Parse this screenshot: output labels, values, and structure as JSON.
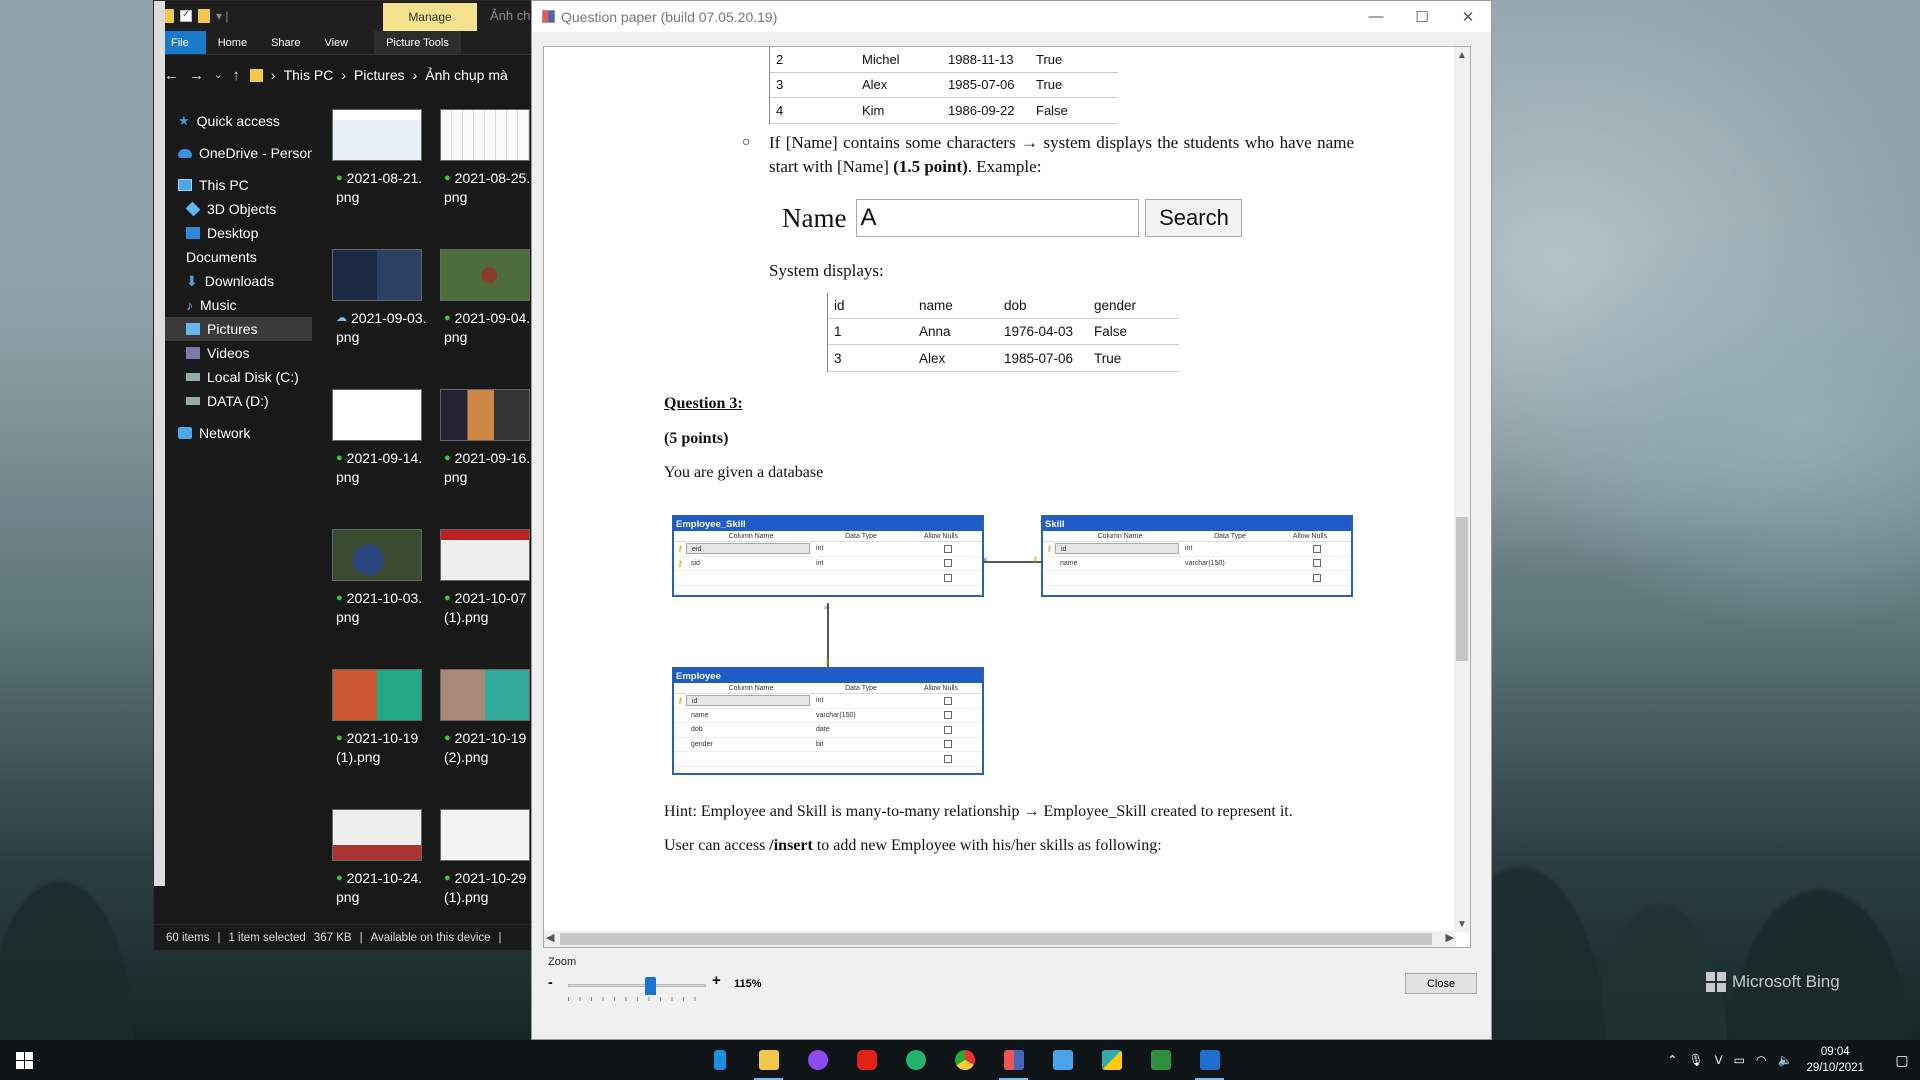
{
  "explorer": {
    "manage_label": "Manage",
    "title_partial": "Ảnh ch",
    "ribbon": {
      "file": "File",
      "home": "Home",
      "share": "Share",
      "view": "View",
      "picture_tools": "Picture Tools"
    },
    "address": {
      "this_pc": "This PC",
      "pictures": "Pictures",
      "folder": "Ảnh chụp mà"
    },
    "nav": {
      "quick_access": "Quick access",
      "onedrive": "OneDrive - Person",
      "this_pc": "This PC",
      "objects3d": "3D Objects",
      "desktop": "Desktop",
      "documents": "Documents",
      "downloads": "Downloads",
      "music": "Music",
      "pictures": "Pictures",
      "videos": "Videos",
      "local_disk": "Local Disk (C:)",
      "data": "DATA (D:)",
      "network": "Network"
    },
    "files": [
      {
        "l1": "2021-08-21.",
        "l2": "png"
      },
      {
        "l1": "2021-08-25.",
        "l2": "png"
      },
      {
        "l1": "2021-09-03.",
        "l2": "png"
      },
      {
        "l1": "2021-09-04.",
        "l2": "png"
      },
      {
        "l1": "2021-09-14.",
        "l2": "png"
      },
      {
        "l1": "2021-09-16.",
        "l2": "png"
      },
      {
        "l1": "2021-10-03.",
        "l2": "png"
      },
      {
        "l1": "2021-10-07",
        "l2": "(1).png"
      },
      {
        "l1": "2021-10-19",
        "l2": "(1).png"
      },
      {
        "l1": "2021-10-19",
        "l2": "(2).png"
      },
      {
        "l1": "2021-10-24.",
        "l2": "png"
      },
      {
        "l1": "2021-10-29",
        "l2": "(1).png"
      }
    ],
    "status": {
      "items": "60 items",
      "selected": "1 item selected",
      "size": "367 KB",
      "availability": "Available on this device"
    }
  },
  "qp": {
    "title": "Question paper (build 07.05.20.19)",
    "top_table": [
      {
        "id": "2",
        "name": "Michel",
        "dob": "1988-11-13",
        "gender": "True"
      },
      {
        "id": "3",
        "name": "Alex",
        "dob": "1985-07-06",
        "gender": "True"
      },
      {
        "id": "4",
        "name": "Kim",
        "dob": "1986-09-22",
        "gender": "False"
      }
    ],
    "bullet_a": "If [Name] contains some characters",
    "bullet_b": " system displays the students who have name start with [Name] ",
    "bullet_bold": "(1.5 point)",
    "bullet_c": ". Example:",
    "search_label": "Name",
    "search_value": "A",
    "search_button": "Search",
    "system_displays": "System displays:",
    "result_headers": {
      "id": "id",
      "name": "name",
      "dob": "dob",
      "gender": "gender"
    },
    "result_rows": [
      {
        "id": "1",
        "name": "Anna",
        "dob": "1976-04-03",
        "gender": "False"
      },
      {
        "id": "3",
        "name": "Alex",
        "dob": "1985-07-06",
        "gender": "True"
      }
    ],
    "question_title": "Question 3:",
    "question_points": "(5 points)",
    "given": "You are given a database",
    "diagram": {
      "col_headers": {
        "name": "Column Name",
        "type": "Data Type",
        "nulls": "Allow Nulls"
      },
      "employee_skill": {
        "title": "Employee_Skill",
        "rows": [
          {
            "name": "eid",
            "type": "int"
          },
          {
            "name": "sid",
            "type": "int"
          }
        ]
      },
      "skill": {
        "title": "Skill",
        "rows": [
          {
            "name": "id",
            "type": "int"
          },
          {
            "name": "name",
            "type": "varchar(150)"
          }
        ]
      },
      "employee": {
        "title": "Employee",
        "rows": [
          {
            "name": "id",
            "type": "int"
          },
          {
            "name": "name",
            "type": "varchar(150)"
          },
          {
            "name": "dob",
            "type": "date"
          },
          {
            "name": "gender",
            "type": "bit"
          }
        ]
      }
    },
    "hint": "Hint: Employee and Skill is many-to-many relationship",
    "hint_end": " Employee_Skill created to represent it.",
    "access_a": "User can access ",
    "access_bold": "/insert",
    "access_c": " to add new Employee with his/her skills as following:",
    "zoom_label": "Zoom",
    "zoom_value": "115%",
    "zoom_fraction": 0.6,
    "close": "Close"
  },
  "bing": "Microsoft Bing",
  "clock": {
    "time": "09:04",
    "date": "29/10/2021"
  }
}
